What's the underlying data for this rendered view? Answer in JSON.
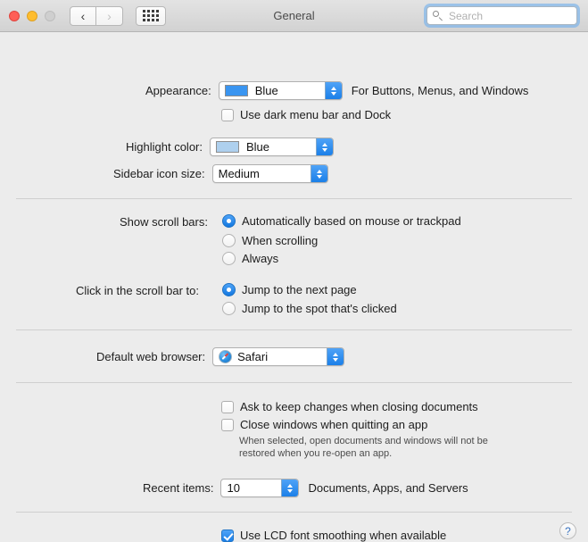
{
  "window": {
    "title": "General",
    "traffic_lights": [
      "close",
      "minimize",
      "zoom"
    ],
    "back_label": "‹",
    "forward_label": "›",
    "showall_label": "show-all-grid"
  },
  "search": {
    "placeholder": "Search",
    "value": ""
  },
  "appearance": {
    "label": "Appearance:",
    "value": "Blue",
    "swatch_color": "#3a95f0",
    "note": "For Buttons, Menus, and Windows",
    "dark_menu_label": "Use dark menu bar and Dock",
    "dark_menu_checked": false
  },
  "highlight": {
    "label": "Highlight color:",
    "value": "Blue",
    "swatch_color": "#aed0ee"
  },
  "sidebar_icon": {
    "label": "Sidebar icon size:",
    "value": "Medium"
  },
  "scroll_bars": {
    "label": "Show scroll bars:",
    "options": [
      {
        "label": "Automatically based on mouse or trackpad",
        "selected": true
      },
      {
        "label": "When scrolling",
        "selected": false
      },
      {
        "label": "Always",
        "selected": false
      }
    ]
  },
  "scroll_click": {
    "label": "Click in the scroll bar to:",
    "options": [
      {
        "label": "Jump to the next page",
        "selected": true
      },
      {
        "label": "Jump to the spot that's clicked",
        "selected": false
      }
    ]
  },
  "browser": {
    "label": "Default web browser:",
    "value": "Safari",
    "icon": "safari-icon"
  },
  "documents": {
    "ask_keep_label": "Ask to keep changes when closing documents",
    "ask_keep_checked": false,
    "close_windows_label": "Close windows when quitting an app",
    "close_windows_checked": false,
    "close_windows_hint": "When selected, open documents and windows will not be restored when you re-open an app."
  },
  "recent_items": {
    "label": "Recent items:",
    "value": "10",
    "note": "Documents, Apps, and Servers"
  },
  "font_smoothing": {
    "label": "Use LCD font smoothing when available",
    "checked": true
  },
  "help": {
    "label": "?"
  }
}
